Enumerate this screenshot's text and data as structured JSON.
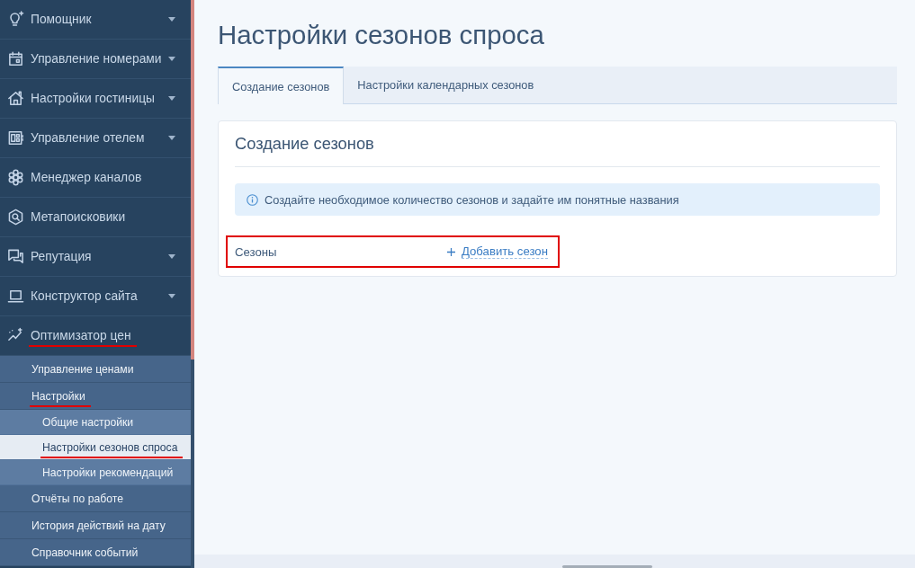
{
  "sidebar": {
    "items": [
      {
        "label": "Помощник",
        "expandable": true,
        "marked": false
      },
      {
        "label": "Управление номерами",
        "expandable": true,
        "marked": false
      },
      {
        "label": "Настройки гостиницы",
        "expandable": true,
        "marked": false
      },
      {
        "label": "Управление отелем",
        "expandable": true,
        "marked": false
      },
      {
        "label": "Менеджер каналов",
        "expandable": false,
        "marked": false
      },
      {
        "label": "Метапоисковики",
        "expandable": false,
        "marked": false
      },
      {
        "label": "Репутация",
        "expandable": true,
        "marked": false
      },
      {
        "label": "Конструктор сайта",
        "expandable": true,
        "marked": false
      },
      {
        "label": "Оптимизатор цен",
        "expanded": true,
        "marked": true,
        "children": [
          {
            "label": "Управление ценами",
            "marked": false
          },
          {
            "label": "Настройки",
            "marked": true,
            "expanded": true,
            "children": [
              {
                "label": "Общие настройки",
                "selected": false,
                "marked": false
              },
              {
                "label": "Настройки сезонов спроса",
                "selected": true,
                "marked": true
              },
              {
                "label": "Настройки рекомендаций",
                "selected": false,
                "marked": false
              }
            ]
          },
          {
            "label": "Отчёты по работе",
            "marked": false
          },
          {
            "label": "История действий на дату",
            "marked": false
          },
          {
            "label": "Справочник событий",
            "marked": false
          }
        ]
      }
    ]
  },
  "page": {
    "title": "Настройки сезонов спроса"
  },
  "tabs": [
    {
      "label": "Создание сезонов",
      "selected": true
    },
    {
      "label": "Настройки календарных сезонов",
      "selected": false
    }
  ],
  "card": {
    "title": "Создание сезонов",
    "info": "Создайте необходимое количество сезонов и задайте им понятные названия",
    "seasons": {
      "label": "Сезоны",
      "add_link": "Добавить сезон",
      "marked": true
    }
  }
}
